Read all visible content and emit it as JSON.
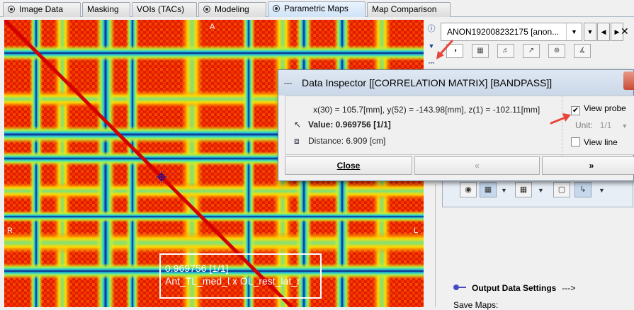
{
  "tabs": [
    {
      "label": "Image Data",
      "icon": "radio-icon",
      "active": false
    },
    {
      "label": "Masking",
      "icon": "",
      "active": false
    },
    {
      "label": "VOIs (TACs)",
      "icon": "",
      "active": false
    },
    {
      "label": "Modeling",
      "icon": "radio-icon",
      "active": false
    },
    {
      "label": "Parametric Maps",
      "icon": "radio-icon",
      "active": true
    },
    {
      "label": "Map Comparison",
      "icon": "",
      "active": false
    }
  ],
  "viewer": {
    "orientation": {
      "top": "A",
      "left": "R",
      "right": "L"
    },
    "overlay_value": "0.969756 [1/1]",
    "overlay_label": "Ant_TL_med_l x OL_rest_lat_r"
  },
  "right_panel": {
    "dataset_combo": "ANON192008232175 [anon...",
    "output_settings_label": "Output Data Settings",
    "output_settings_arrow": "--->",
    "save_maps_label": "Save Maps:"
  },
  "dialog": {
    "title": "Data Inspector [[CORRELATION MATRIX] [BANDPASS]]",
    "coords": "x(30) = 105.7[mm],  y(52) = -143.98[mm],  z(1) = -102.11[mm]",
    "value": "Value: 0.969756 [1/1]",
    "distance": "Distance: 6.909 [cm]",
    "view_probe_label": "View probe",
    "view_probe_checked": true,
    "unit_label": "Unit:",
    "unit_value": "1/1",
    "view_line_label": "View line",
    "view_line_checked": false,
    "close_label": "Close",
    "prev_label": "«",
    "next_label": "»"
  },
  "colors": {
    "accent_red": "#e8453c",
    "heatmap_low": "#00008f",
    "heatmap_high": "#d40000"
  }
}
